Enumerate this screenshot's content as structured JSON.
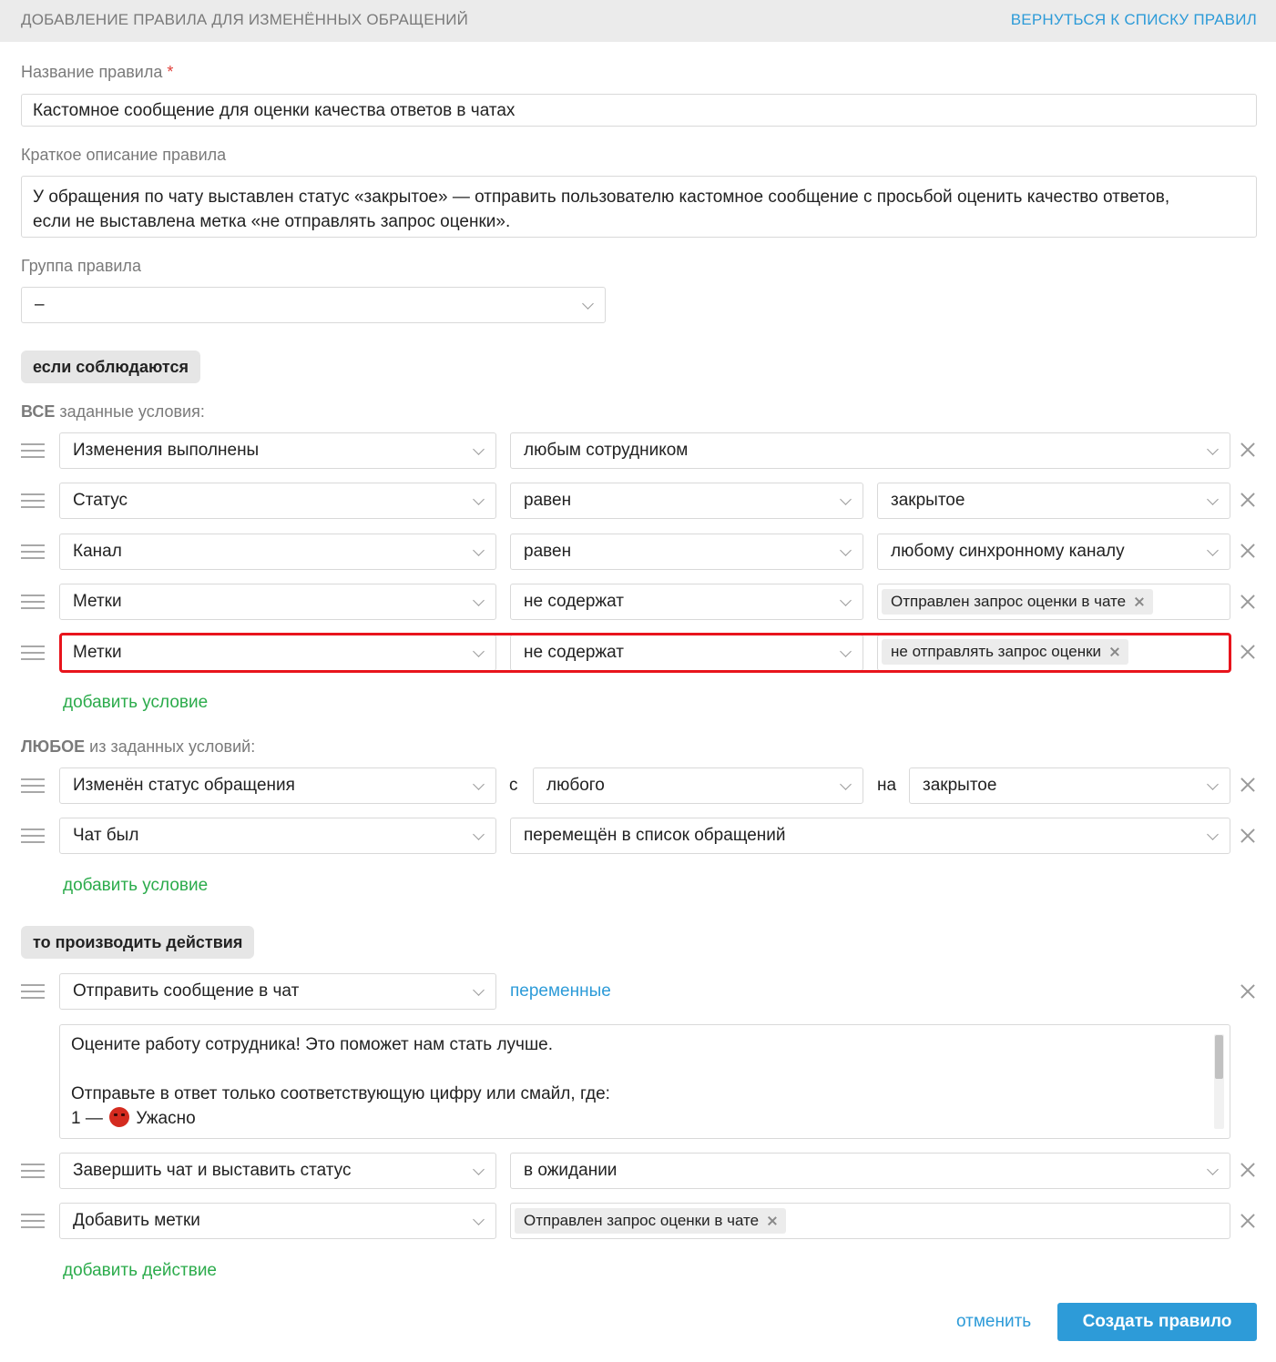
{
  "header": {
    "title": "ДОБАВЛЕНИЕ ПРАВИЛА ДЛЯ ИЗМЕНЁННЫХ ОБРАЩЕНИЙ",
    "back_link": "ВЕРНУТЬСЯ К СПИСКУ ПРАВИЛ"
  },
  "form": {
    "name_label": "Название правила",
    "name_required": "*",
    "name_value": "Кастомное сообщение для оценки качества ответов в чатах",
    "desc_label": "Краткое описание правила",
    "desc_line1": "У обращения по чату выставлен статус «закрытое» — отправить пользователю кастомное сообщение с просьбой оценить качество ответов,",
    "desc_line2": "если не выставлена метка «не отправлять запрос оценки».",
    "group_label": "Группа правила",
    "group_value": "–"
  },
  "conditions": {
    "section_title": "если соблюдаются",
    "all_label_bold": "ВСЕ",
    "all_label_rest": " заданные условия:",
    "all_rows": [
      {
        "field": "Изменения выполнены",
        "op": "любым сотрудником"
      },
      {
        "field": "Статус",
        "op": "равен",
        "value": "закрытое"
      },
      {
        "field": "Канал",
        "op": "равен",
        "value": "любому синхронному каналу"
      },
      {
        "field": "Метки",
        "op": "не содержат",
        "tag": "Отправлен запрос оценки в чате"
      },
      {
        "field": "Метки",
        "op": "не содержат",
        "tag": "не отправлять запрос оценки"
      }
    ],
    "add_condition": "добавить условие",
    "any_label_bold": "ЛЮБОЕ",
    "any_label_rest": " из заданных условий:",
    "any_rows": [
      {
        "field": "Изменён статус обращения",
        "from_word": "с",
        "from": "любого",
        "to_word": "на",
        "to": "закрытое"
      },
      {
        "field": "Чат был",
        "op": "перемещён в список обращений"
      }
    ],
    "add_condition_2": "добавить условие"
  },
  "actions": {
    "section_title": "то производить действия",
    "rows": [
      {
        "action": "Отправить сообщение в чат",
        "variables_link": "переменные"
      },
      {
        "action": "Завершить чат и выставить статус",
        "value": "в ожидании"
      },
      {
        "action": "Добавить метки",
        "tag": "Отправлен запрос оценки в чате"
      }
    ],
    "message_lines": [
      "Оцените работу сотрудника! Это поможет нам стать лучше.",
      "",
      "Отправьте в ответ только соответствующую цифру или смайл, где:",
      "1 — ",
      "Ужасно"
    ],
    "add_action": "добавить действие"
  },
  "footer": {
    "cancel": "отменить",
    "submit": "Создать правило"
  },
  "colors": {
    "accent_blue": "#2d9bd8",
    "link_green": "#2bab4b",
    "highlight_red": "#e8141c"
  }
}
